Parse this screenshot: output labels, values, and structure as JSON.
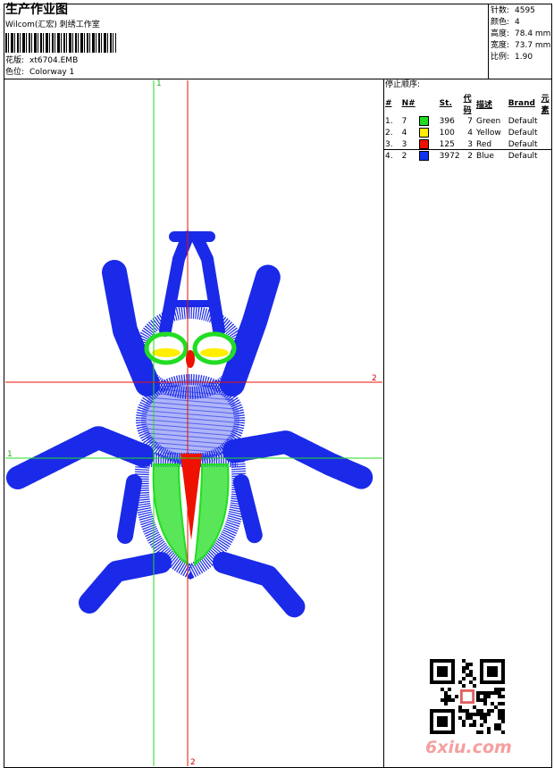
{
  "header": {
    "title": "生产作业图",
    "company": "Wilcom(汇宏) 刺绣工作室",
    "design_label": "花版:",
    "design_value": "xt6704.EMB",
    "colorway_label": "色位:",
    "colorway_value": "Colorway 1"
  },
  "stats": [
    {
      "label": "针数:",
      "value": "4595"
    },
    {
      "label": "颜色:",
      "value": "4"
    },
    {
      "label": "高度:",
      "value": "78.4 mm"
    },
    {
      "label": "宽度:",
      "value": "73.7 mm"
    },
    {
      "label": "比例:",
      "value": "1.90"
    }
  ],
  "stop_sequence": {
    "title": "停止顺序:",
    "columns": [
      "#",
      "N#",
      "St.",
      "代码",
      "描述",
      "Brand",
      "元素"
    ],
    "rows": [
      {
        "idx": "1.",
        "n": "7",
        "color": "#22dd22",
        "st": "396",
        "code": "7",
        "desc": "Green",
        "brand": "Default"
      },
      {
        "idx": "2.",
        "n": "4",
        "color": "#ffee00",
        "st": "100",
        "code": "4",
        "desc": "Yellow",
        "brand": "Default"
      },
      {
        "idx": "3.",
        "n": "3",
        "color": "#ee1100",
        "st": "125",
        "code": "3",
        "desc": "Red",
        "brand": "Default"
      },
      {
        "idx": "4.",
        "n": "2",
        "color": "#1133ee",
        "st": "3972",
        "code": "2",
        "desc": "Blue",
        "brand": "Default"
      }
    ]
  },
  "axis_labels": {
    "green_v": "1",
    "green_h": "1",
    "red_h": "2",
    "red_v": "2"
  },
  "logo": "6xiu.com",
  "colors": {
    "blue": "#1a2ae8",
    "green": "#22dd22",
    "red": "#ee1100",
    "yellow": "#ffee00"
  },
  "icons": [
    "barcode-icon",
    "qr-code-icon",
    "embroidery-design-image"
  ]
}
